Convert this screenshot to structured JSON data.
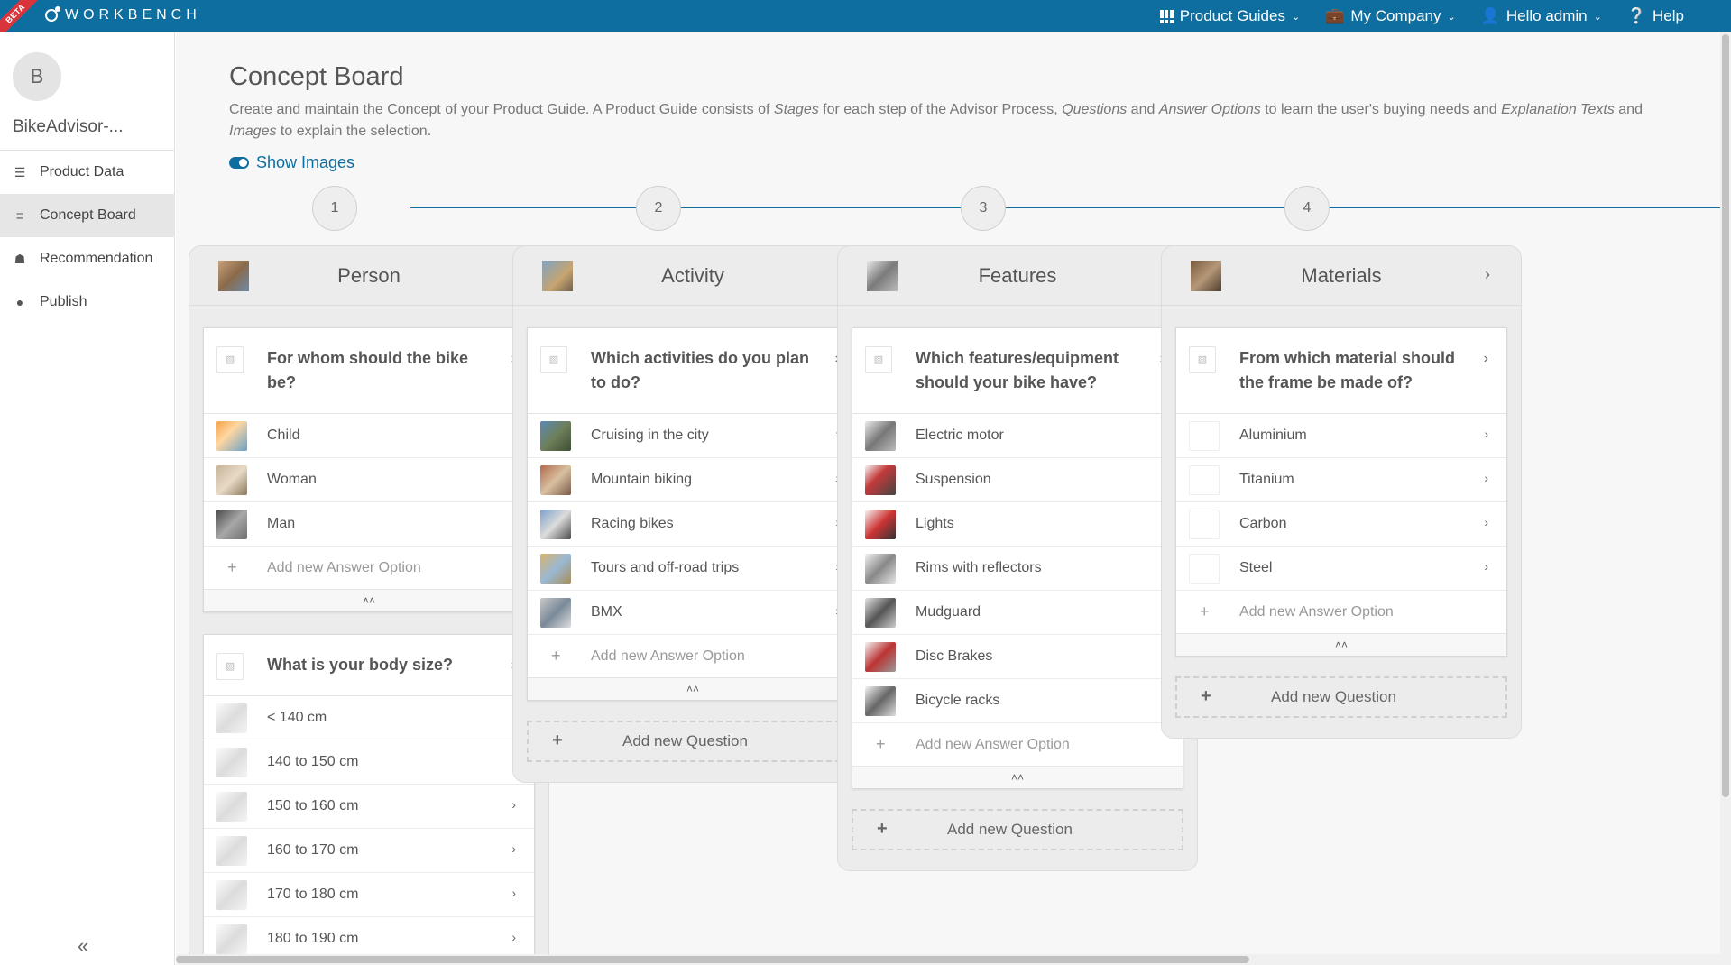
{
  "app": {
    "brand": "WORKBENCH",
    "badge": "BETA"
  },
  "topnav": {
    "product_guides": "Product Guides",
    "company": "My Company",
    "user": "Hello admin",
    "help": "Help"
  },
  "sidebar": {
    "avatar_letter": "B",
    "project": "BikeAdvisor-...",
    "items": [
      {
        "label": "Product Data",
        "icon": "database-icon"
      },
      {
        "label": "Concept Board",
        "icon": "board-icon",
        "active": true
      },
      {
        "label": "Recommendation",
        "icon": "gift-icon"
      },
      {
        "label": "Publish",
        "icon": "globe-icon"
      }
    ],
    "collapse": "«"
  },
  "main": {
    "title": "Concept Board",
    "description_html": "Create and maintain the Concept of your Product Guide. A Product Guide consists of <i>Stages</i> for each step of the Advisor Process, <i>Questions</i> and <i>Answer Options</i> to learn the user's buying needs and <i>Explanation Texts</i> and <i>Images</i> to explain the selection.",
    "toggle_label": "Show Images",
    "steps": [
      "1",
      "2",
      "3",
      "4"
    ],
    "add_option": "Add new Answer Option",
    "add_question": "Add new Question",
    "stages": [
      {
        "title": "Person",
        "thumb": "t-a",
        "questions": [
          {
            "text": "For whom should the bike be?",
            "options": [
              {
                "label": "Child",
                "thumb": "t-child"
              },
              {
                "label": "Woman",
                "thumb": "t-woman"
              },
              {
                "label": "Man",
                "thumb": "t-man"
              }
            ]
          },
          {
            "text": "What is your body size?",
            "options": [
              {
                "label": "< 140 cm",
                "thumb": "t-size"
              },
              {
                "label": "140 to 150 cm",
                "thumb": "t-size"
              },
              {
                "label": "150 to 160 cm",
                "thumb": "t-size"
              },
              {
                "label": "160 to 170 cm",
                "thumb": "t-size"
              },
              {
                "label": "170 to 180 cm",
                "thumb": "t-size"
              },
              {
                "label": "180 to 190 cm",
                "thumb": "t-size"
              }
            ]
          }
        ]
      },
      {
        "title": "Activity",
        "thumb": "t-b",
        "questions": [
          {
            "text": "Which activities do you plan to do?",
            "options": [
              {
                "label": "Cruising in the city",
                "thumb": "t-city"
              },
              {
                "label": "Mountain biking",
                "thumb": "t-mtb"
              },
              {
                "label": "Racing bikes",
                "thumb": "t-race"
              },
              {
                "label": "Tours and off-road trips",
                "thumb": "t-tour"
              },
              {
                "label": "BMX",
                "thumb": "t-bmx"
              }
            ]
          }
        ]
      },
      {
        "title": "Features",
        "thumb": "t-c",
        "questions": [
          {
            "text": "Which features/equipment should your bike have?",
            "options": [
              {
                "label": "Electric motor",
                "thumb": "t-motor"
              },
              {
                "label": "Suspension",
                "thumb": "t-susp"
              },
              {
                "label": "Lights",
                "thumb": "t-light"
              },
              {
                "label": "Rims with reflectors",
                "thumb": "t-rims"
              },
              {
                "label": "Mudguard",
                "thumb": "t-mud"
              },
              {
                "label": "Disc Brakes",
                "thumb": "t-disc"
              },
              {
                "label": "Bicycle racks",
                "thumb": "t-rack"
              }
            ]
          }
        ]
      },
      {
        "title": "Materials",
        "thumb": "t-d",
        "questions": [
          {
            "text": "From which material should the frame be made of?",
            "options": [
              {
                "label": "Aluminium",
                "thumb": "t-frame"
              },
              {
                "label": "Titanium",
                "thumb": "t-frame"
              },
              {
                "label": "Carbon",
                "thumb": "t-frame"
              },
              {
                "label": "Steel",
                "thumb": "t-frame"
              }
            ]
          }
        ]
      }
    ]
  }
}
